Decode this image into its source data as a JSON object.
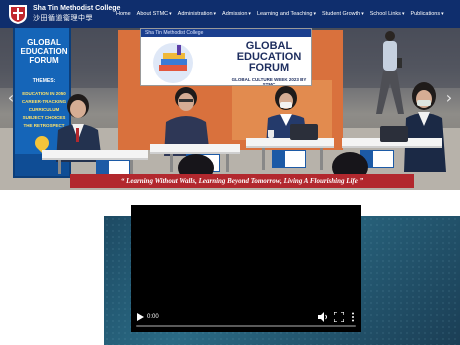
{
  "header": {
    "school_name_en": "Sha Tin Methodist College",
    "school_name_zh": "沙田循道衞理中學",
    "logo_icon": "school-crest-icon"
  },
  "nav": {
    "items": [
      {
        "label": "Home",
        "has_dropdown": false
      },
      {
        "label": "About STMC",
        "has_dropdown": true
      },
      {
        "label": "Administration",
        "has_dropdown": true
      },
      {
        "label": "Admission",
        "has_dropdown": true
      },
      {
        "label": "Learning and Teaching",
        "has_dropdown": true
      },
      {
        "label": "Student Growth",
        "has_dropdown": true
      },
      {
        "label": "School Links",
        "has_dropdown": true
      },
      {
        "label": "Publications",
        "has_dropdown": true
      }
    ],
    "caret": "▾"
  },
  "hero": {
    "left_banner": {
      "title": "GLOBAL EDUCATION FORUM",
      "subtitle": "THEMES:",
      "themes": [
        "EDUCATION IN 2050",
        "CAREER-TRACKING",
        "CURRICULUM",
        "SUBJECT CHOICES",
        "THE RETROSPECT"
      ]
    },
    "forum_board": {
      "strip_text": "Sha Tin Methodist College",
      "title": "GLOBAL EDUCATION FORUM",
      "subtitle": "GLOBAL CULTURE WEEK 2023 BY STMC"
    },
    "ribbon_text": "“ Learning Without Walls, Learning Beyond Tomorrow, Living A Flourishing Life ”",
    "prev_icon": "‹",
    "next_icon": "›",
    "accent_color": "#b2282e",
    "nav_color": "#0f2e6d"
  },
  "video": {
    "time": "0:00",
    "progress": 0
  }
}
